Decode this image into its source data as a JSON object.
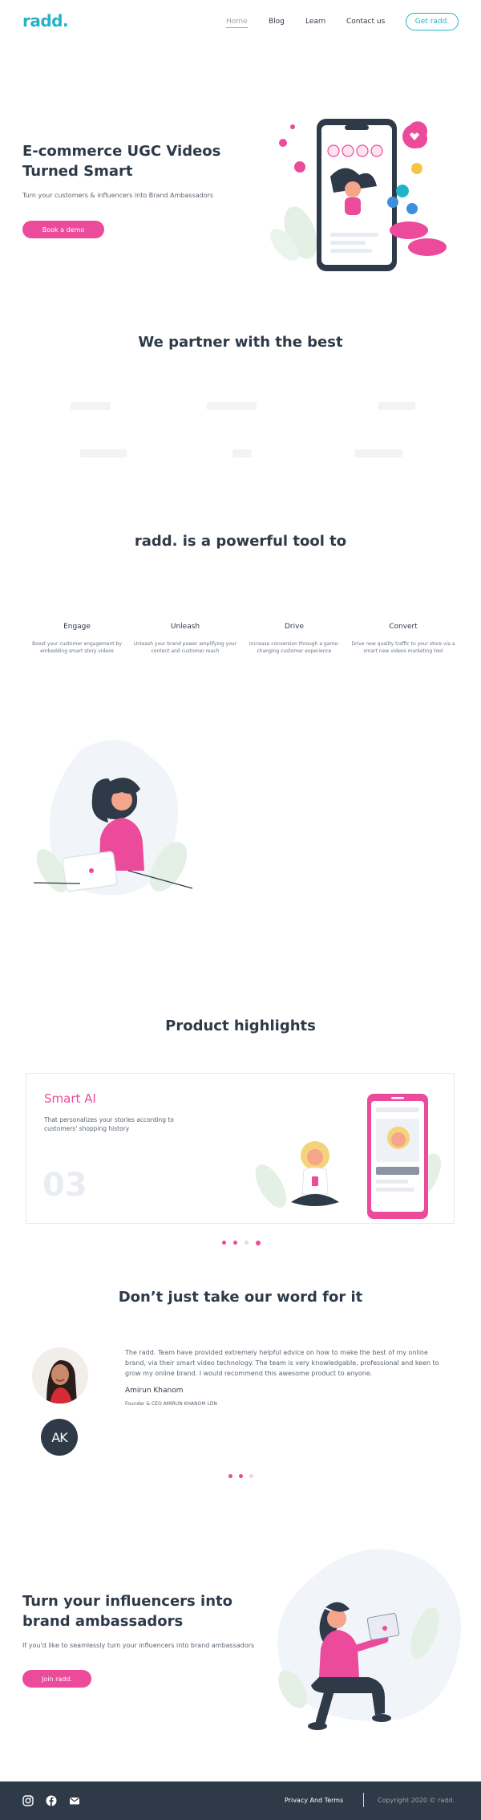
{
  "header": {
    "logo": "radd.",
    "nav": [
      {
        "label": "Home",
        "active": true
      },
      {
        "label": "Blog",
        "active": false
      },
      {
        "label": "Learn",
        "active": false
      },
      {
        "label": "Contact us",
        "active": false
      }
    ],
    "cta_label": "Get radd."
  },
  "hero": {
    "title_line1": "E-commerce UGC Videos",
    "title_line2": "Turned Smart",
    "subtitle": "Turn your customers & influencers into Brand Ambassadors",
    "button_label": "Book a demo"
  },
  "partners": {
    "title": "We partner with the best"
  },
  "tools": {
    "title": "radd. is a powerful tool to",
    "items": [
      {
        "title": "Engage",
        "desc": "Boost your customer engagement by embedding smart story videos"
      },
      {
        "title": "Unleash",
        "desc": "Unleash your brand power amplifying your content and customer reach"
      },
      {
        "title": "Drive",
        "desc": "Increase conversion through a game-changing customer experience"
      },
      {
        "title": "Convert",
        "desc": "Drive new quality traffic to your store via a smart new videos marketing tool"
      }
    ]
  },
  "highlights": {
    "title": "Product highlights",
    "card_title": "Smart AI",
    "card_desc": "That personalizes your stories according to customers' shopping history",
    "card_number": "03",
    "dots_total": 4,
    "dots_active_index": 3
  },
  "testimonials": {
    "title": "Don’t just take our word for it",
    "quote": "The radd. Team have provided extremely helpful advice on how to make the best of my online brand, via their smart video technology. The team is very knowledgable, professional and keen to grow my online brand. I would recommend this awesome product to anyone.",
    "name": "Amirun Khanom",
    "role": "Founder & CEO AMIRUN KHANOM LDN",
    "initials": "AK",
    "dots_total": 3
  },
  "cta": {
    "title_line1": "Turn your influencers into",
    "title_line2": "brand ambassadors",
    "subtitle": "If you'd like to seamlessly turn your influencers into brand ambassadors",
    "button_label": "Join radd."
  },
  "footer": {
    "icons": [
      "instagram-icon",
      "facebook-icon",
      "mail-icon"
    ],
    "link_label": "Privacy And Terms",
    "copyright": "Copyright 2020 © radd."
  },
  "colors": {
    "brand": "#22b3c8",
    "accent": "#ec4a9a",
    "dark": "#2e3a48"
  }
}
